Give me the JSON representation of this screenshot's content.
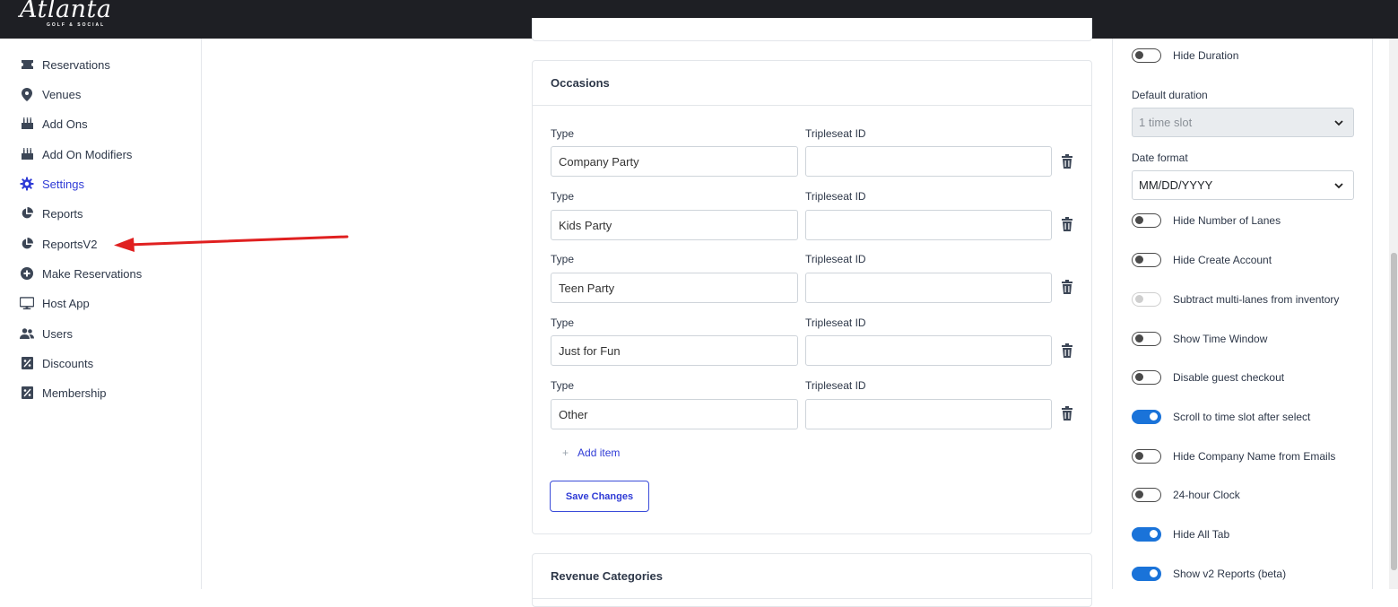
{
  "brand": {
    "logo_main": "Atlanta",
    "logo_sub": "GOLF & SOCIAL"
  },
  "sidebar": {
    "items": [
      {
        "label": "Reservations",
        "icon": "ticket-icon"
      },
      {
        "label": "Venues",
        "icon": "map-pin-icon"
      },
      {
        "label": "Add Ons",
        "icon": "cake-icon"
      },
      {
        "label": "Add On Modifiers",
        "icon": "cake-icon"
      },
      {
        "label": "Settings",
        "icon": "gear-icon",
        "active": true
      },
      {
        "label": "Reports",
        "icon": "pie-chart-icon"
      },
      {
        "label": "ReportsV2",
        "icon": "pie-chart-icon"
      },
      {
        "label": "Make Reservations",
        "icon": "plus-circle-icon"
      },
      {
        "label": "Host App",
        "icon": "monitor-icon"
      },
      {
        "label": "Users",
        "icon": "users-icon"
      },
      {
        "label": "Discounts",
        "icon": "discount-icon"
      },
      {
        "label": "Membership",
        "icon": "discount-icon"
      }
    ]
  },
  "occasions": {
    "title": "Occasions",
    "type_label": "Type",
    "id_label": "Tripleseat ID",
    "rows": [
      {
        "type": "Company Party",
        "id": ""
      },
      {
        "type": "Kids Party",
        "id": ""
      },
      {
        "type": "Teen Party",
        "id": ""
      },
      {
        "type": "Just for Fun",
        "id": ""
      },
      {
        "type": "Other",
        "id": ""
      }
    ],
    "add_item": "Add item",
    "save": "Save Changes"
  },
  "revenue": {
    "title": "Revenue Categories"
  },
  "settings": {
    "hide_duration": {
      "label": "Hide Duration",
      "on": false
    },
    "default_duration_label": "Default duration",
    "default_duration_value": "1 time slot",
    "date_format_label": "Date format",
    "date_format_value": "MM/DD/YYYY",
    "toggles": [
      {
        "label": "Hide Number of Lanes",
        "state": "off"
      },
      {
        "label": "Hide Create Account",
        "state": "off"
      },
      {
        "label": "Subtract multi-lanes from inventory",
        "state": "disabled"
      },
      {
        "label": "Show Time Window",
        "state": "off"
      },
      {
        "label": "Disable guest checkout",
        "state": "off"
      },
      {
        "label": "Scroll to time slot after select",
        "state": "on"
      },
      {
        "label": "Hide Company Name from Emails",
        "state": "off"
      },
      {
        "label": "24-hour Clock",
        "state": "off"
      },
      {
        "label": "Hide All Tab",
        "state": "on"
      },
      {
        "label": "Show v2 Reports (beta)",
        "state": "on"
      }
    ]
  },
  "colors": {
    "accent": "#2f3bd6",
    "toggle_on": "#1a73d9",
    "topbar": "#1e1f24",
    "annotation_arrow": "#e02020"
  }
}
